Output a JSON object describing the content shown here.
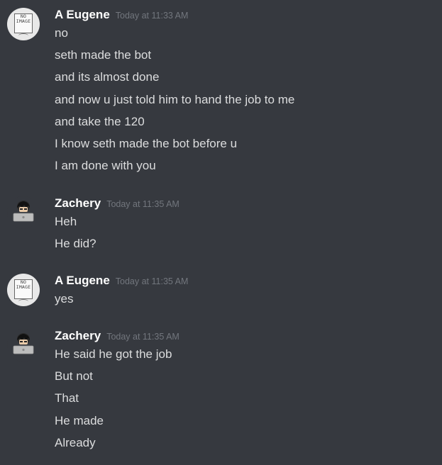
{
  "groups": [
    {
      "author": "A Eugene",
      "timestamp": "Today at 11:33 AM",
      "avatar": "no-image-avatar",
      "messages": [
        "no",
        "seth made the bot",
        "and its almost done",
        "and now u just told him to hand the job to me",
        "and take the 120",
        "I know seth made the bot before u",
        "I am done with you"
      ]
    },
    {
      "author": "Zachery",
      "timestamp": "Today at 11:35 AM",
      "avatar": "person-laptop-avatar",
      "messages": [
        "Heh",
        "He did?"
      ]
    },
    {
      "author": "A Eugene",
      "timestamp": "Today at 11:35 AM",
      "avatar": "no-image-avatar",
      "messages": [
        "yes"
      ]
    },
    {
      "author": "Zachery",
      "timestamp": "Today at 11:35 AM",
      "avatar": "person-laptop-avatar",
      "messages": [
        "He said he got the job",
        "But not",
        "That",
        "He made",
        "Already"
      ]
    }
  ],
  "avatar_placeholder_text": [
    "NO",
    "IMAGE"
  ],
  "colors": {
    "background": "#36393f",
    "username": "#ffffff",
    "message": "#dcddde",
    "timestamp": "#72767d"
  }
}
